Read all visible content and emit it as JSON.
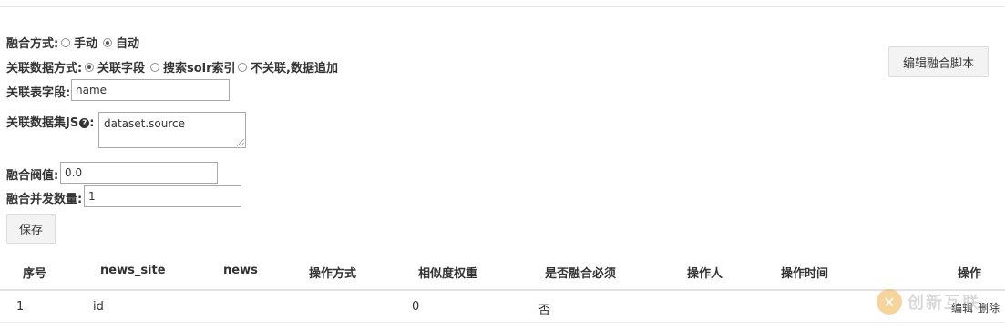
{
  "form": {
    "fusion_mode_label": "融合方式:",
    "fusion_mode_options": [
      "手动",
      "自动"
    ],
    "fusion_mode_selected": "自动",
    "assoc_mode_label": "关联数据方式:",
    "assoc_mode_options": [
      "关联字段",
      "搜索solr索引",
      "不关联,数据追加"
    ],
    "assoc_mode_selected": "关联字段",
    "assoc_field_label": "关联表字段:",
    "assoc_field_value": "name",
    "assoc_js_label": "关联数据集JS",
    "assoc_js_colon": ":",
    "assoc_js_help_icon": "question-circle-icon",
    "assoc_js_value": "dataset.source",
    "threshold_label": "融合阀值:",
    "threshold_value": "0.0",
    "concurrency_label": "融合并发数量:",
    "concurrency_value": "1",
    "save_label": "保存"
  },
  "edit_script_label": "编辑融合脚本",
  "table": {
    "headers": [
      "序号",
      "news_site",
      "news",
      "操作方式",
      "相似度权重",
      "是否融合必须",
      "操作人",
      "操作时间",
      "操作"
    ],
    "rows": [
      {
        "index": "1",
        "news_site": "id",
        "news": "",
        "op_mode": "",
        "weight": "0",
        "required": "否",
        "operator": "",
        "op_time": "",
        "actions": [
          "编辑",
          "删除"
        ]
      }
    ]
  },
  "watermark": {
    "text": "创新互联",
    "icon": "logo-icon",
    "color": "#f1b24a"
  }
}
